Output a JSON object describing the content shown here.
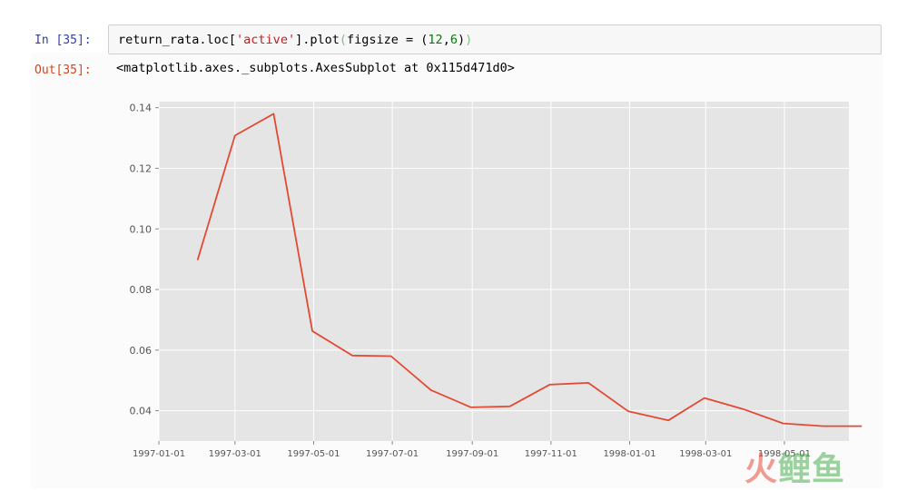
{
  "notebook": {
    "input_prompt": "In [35]:",
    "output_prompt": "Out[35]:",
    "code": {
      "part1": "return_rata.loc[",
      "string": "'active'",
      "part2": "].plot",
      "paren_open": "(",
      "kw": "figsize = ",
      "tuple_open": "(",
      "n1": "12",
      "comma": ",",
      "n2": "6",
      "tuple_close": ")",
      "paren_close": ")"
    },
    "output_text": "<matplotlib.axes._subplots.AxesSubplot at 0x115d471d0>"
  },
  "watermark": {
    "first_char": "火",
    "rest_chars": "鲤鱼"
  },
  "colors": {
    "line": "#e24a33",
    "plot_bg": "#e5e5e5",
    "grid": "#ffffff",
    "tick_text": "#555555"
  },
  "chart_data": {
    "type": "line",
    "title": "",
    "xlabel": "",
    "ylabel": "",
    "grid": true,
    "legend": "none",
    "ylim": [
      0.03,
      0.142
    ],
    "xlim": [
      "1997-01-01",
      "1998-06-20"
    ],
    "yticks": [
      0.04,
      0.06,
      0.08,
      0.1,
      0.12,
      0.14
    ],
    "ytick_labels": [
      "0.04",
      "0.06",
      "0.08",
      "0.10",
      "0.12",
      "0.14"
    ],
    "xticks": [
      "1997-01-01",
      "1997-03-01",
      "1997-05-01",
      "1997-07-01",
      "1997-09-01",
      "1997-11-01",
      "1998-01-01",
      "1998-03-01",
      "1998-05-01"
    ],
    "xtick_labels": [
      "1997-01-01",
      "1997-03-01",
      "1997-05-01",
      "1997-07-01",
      "1997-09-01",
      "1997-11-01",
      "1998-01-01",
      "1998-03-01",
      "1998-05-01"
    ],
    "series": [
      {
        "x": [
          "1997-01-31",
          "1997-03-01",
          "1997-03-31",
          "1997-04-30",
          "1997-05-31",
          "1997-06-30",
          "1997-07-31",
          "1997-08-31",
          "1997-09-30",
          "1997-10-31",
          "1997-11-30",
          "1997-12-31",
          "1998-01-31",
          "1998-02-28",
          "1998-03-31",
          "1998-04-30",
          "1998-05-31",
          "1998-06-30"
        ],
        "y": [
          0.0897,
          0.1308,
          0.138,
          0.0663,
          0.0582,
          0.058,
          0.0468,
          0.0411,
          0.0414,
          0.0486,
          0.0492,
          0.0398,
          0.0368,
          0.0442,
          0.0404,
          0.0358,
          0.0349,
          0.0349
        ]
      }
    ]
  }
}
